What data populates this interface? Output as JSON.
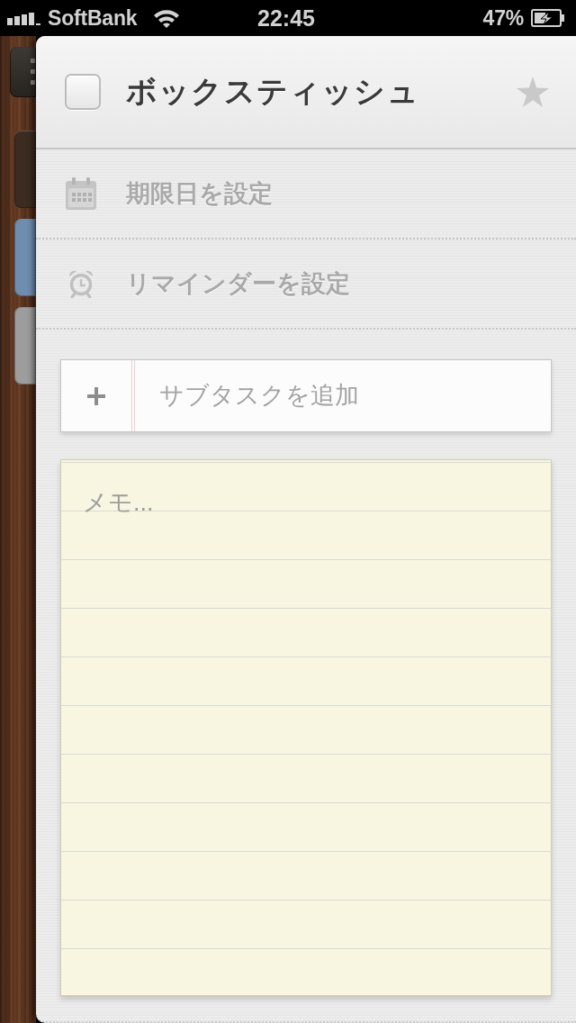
{
  "status_bar": {
    "carrier": "SoftBank",
    "time": "22:45",
    "battery": "47%"
  },
  "side_tiles": [
    {
      "color": "#3b2b20"
    },
    {
      "color": "#6f8db0"
    },
    {
      "color": "#9d9d9d"
    }
  ],
  "task": {
    "title": "ボックスティッシュ",
    "completed": false,
    "starred": false
  },
  "options": [
    {
      "kind": "due_date",
      "label": "期限日を設定"
    },
    {
      "kind": "reminder",
      "label": "リマインダーを設定"
    }
  ],
  "subtask": {
    "placeholder": "サブタスクを追加"
  },
  "note": {
    "placeholder": "メモ..."
  }
}
